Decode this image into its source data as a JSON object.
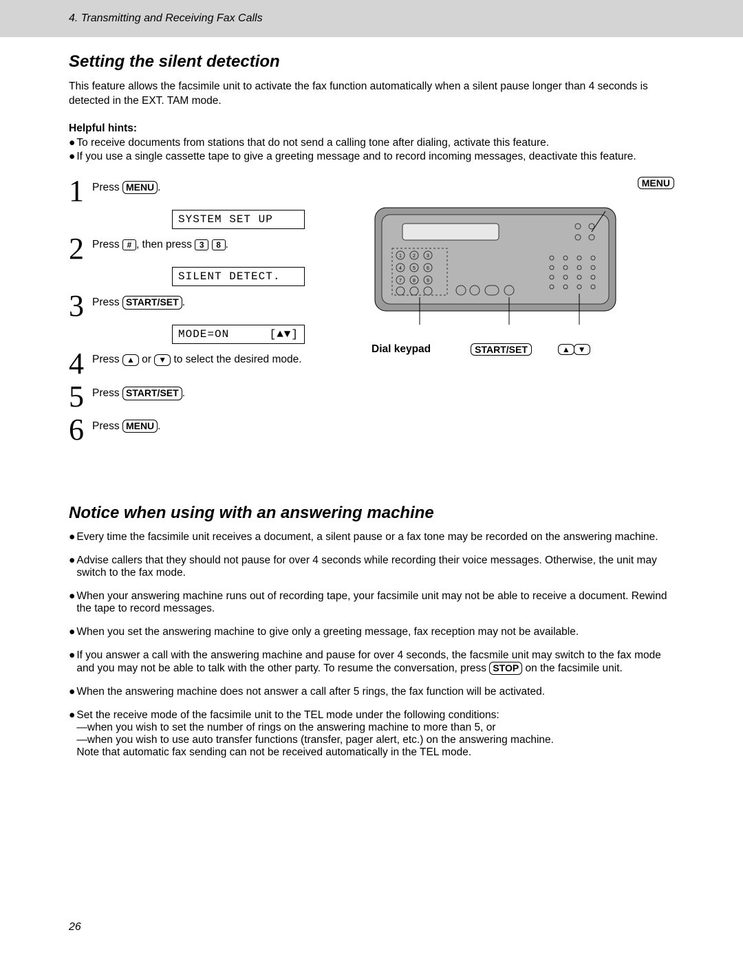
{
  "header": {
    "chapter": "4.  Transmitting and Receiving Fax Calls"
  },
  "section1": {
    "title": "Setting the silent detection",
    "intro": "This feature allows the facsimile unit to activate the fax function automatically when a silent pause longer than 4 seconds is detected in the EXT. TAM mode.",
    "hints_label": "Helpful hints:",
    "hint1": "To receive documents from stations that do not send a calling tone after dialing, activate this feature.",
    "hint2": "If you use a single cassette tape to give a greeting message and to record incoming messages, deactivate this feature."
  },
  "steps": {
    "s1_press": "Press ",
    "s1_key": "MENU",
    "s1_after": ".",
    "lcd1": "SYSTEM SET UP",
    "s2_press": "Press ",
    "s2_key1": "#",
    "s2_mid": ", then press ",
    "s2_key2": "3",
    "s2_key3": "8",
    "s2_after": ".",
    "lcd2": "SILENT DETECT.",
    "s3_press": "Press ",
    "s3_key": "START/SET",
    "s3_after": ".",
    "lcd3a": "MODE=ON",
    "lcd3b": "[▲▼]",
    "s4_p1": "Press ",
    "s4_mid": " or ",
    "s4_p2": " to select the desired mode.",
    "s5_press": "Press ",
    "s5_key": "START/SET",
    "s5_after": ".",
    "s6_press": "Press ",
    "s6_key": "MENU",
    "s6_after": "."
  },
  "devicelabels": {
    "menu": "MENU",
    "dialkeypad": "Dial keypad",
    "startset": "START/SET",
    "up": "▲",
    "down": "▼"
  },
  "section2": {
    "title": "Notice when using with an answering machine",
    "n1": "Every time the facsimile unit receives a document, a silent pause or a fax tone may be recorded on the answering machine.",
    "n2": "Advise callers that they should not pause for over 4 seconds while recording their voice messages. Otherwise, the unit may switch to the fax mode.",
    "n3": "When your answering machine runs out of recording tape, your facsimile unit may not be able to receive a document. Rewind the tape to record messages.",
    "n4": "When you set the answering machine to give only a greeting message, fax reception may not be available.",
    "n5a": "If you answer a call with the answering machine and pause for over 4 seconds, the facsmile unit may switch to the fax mode and you may not be able to talk with the other party. To resume the conversation, press ",
    "n5key": "STOP",
    "n5b": " on the facsimile unit.",
    "n6": "When the answering machine does not answer a call after 5 rings, the fax function will be activated.",
    "n7a": "Set the receive mode of the facsimile unit to the TEL mode under the following conditions:",
    "n7b": "—when you wish to set the number of rings on the answering machine to more than 5, or",
    "n7c": "—when you wish to use auto transfer functions (transfer, pager alert, etc.) on the answering machine.",
    "n7d": "Note that automatic fax sending can not be received automatically in the TEL mode."
  },
  "pagenum": "26"
}
